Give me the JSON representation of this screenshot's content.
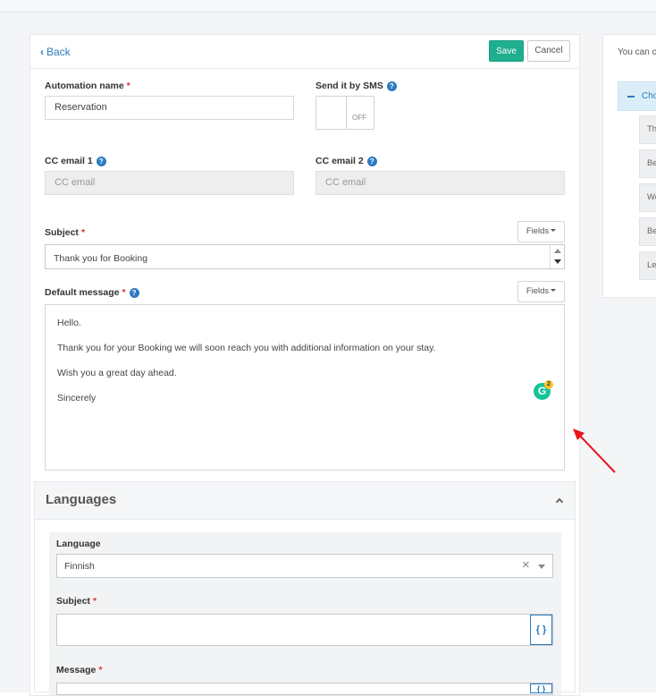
{
  "header": {
    "back_label": "Back",
    "save_label": "Save",
    "cancel_label": "Cancel"
  },
  "form": {
    "automation_name": {
      "label": "Automation name",
      "value": "Reservation"
    },
    "send_sms": {
      "label": "Send it by SMS",
      "state": "OFF"
    },
    "cc_email_1": {
      "label": "CC email 1",
      "placeholder": "CC email"
    },
    "cc_email_2": {
      "label": "CC email 2",
      "placeholder": "CC email"
    },
    "subject": {
      "label": "Subject",
      "value": "Thank you for Booking",
      "fields_label": "Fields"
    },
    "default_message": {
      "label": "Default message",
      "fields_label": "Fields",
      "lines": [
        "Hello.",
        "Thank you for your Booking we will soon reach you with additional information on your stay.",
        "Wish you a great day ahead.",
        "Sincerely"
      ],
      "grammarly_count": "2"
    }
  },
  "languages": {
    "title": "Languages",
    "language_label": "Language",
    "language_value": "Finnish",
    "subject_label": "Subject",
    "message_label": "Message",
    "brace_label": "{ }"
  },
  "side_panel": {
    "intro": "You can c",
    "choose_label": "Cho",
    "items": [
      "Th",
      "Be",
      "We",
      "Be",
      "Le"
    ]
  },
  "colors": {
    "accent_green": "#1fae8f",
    "link_blue": "#2b7bc0",
    "required_red": "#d33333",
    "annotation_red": "#e8141c"
  }
}
